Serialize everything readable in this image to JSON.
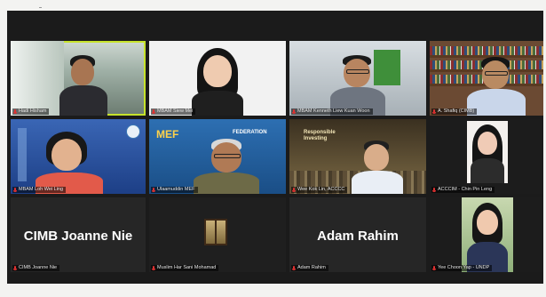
{
  "meeting": {
    "participants": [
      {
        "label": "Hadi Hisham"
      },
      {
        "label": "MBAM Siew Mei"
      },
      {
        "label": "MBAM Kenneth Liew Kuan Woon"
      },
      {
        "label": "A. Shafiq (CIMB)"
      },
      {
        "label": "MBAM Loh Wei Ling"
      },
      {
        "label": "Ulaamuddin MEF"
      },
      {
        "label": "Wee Kok Lin, ACCCC"
      },
      {
        "label": "ACCCIM - Chin Pin Leng"
      },
      {
        "label": "CIMB Joanne Nie",
        "display_name": "CIMB Joanne Nie"
      },
      {
        "label": "Muslim Har Sani Mohamad"
      },
      {
        "label": "Adam Rahim",
        "display_name": "Adam Rahim"
      },
      {
        "label": "Yee Choon Yap - UNDP"
      }
    ],
    "slide": {
      "title_line1": "Responsible",
      "title_line2": "Investing"
    },
    "banner_text": "MEF",
    "banner_text2": "FEDERATION",
    "colors": {
      "active_border": "#c7e32b",
      "muted_mic": "#e03131",
      "background": "#1b1b1b"
    },
    "icons": [
      "microphone-muted-icon"
    ]
  }
}
